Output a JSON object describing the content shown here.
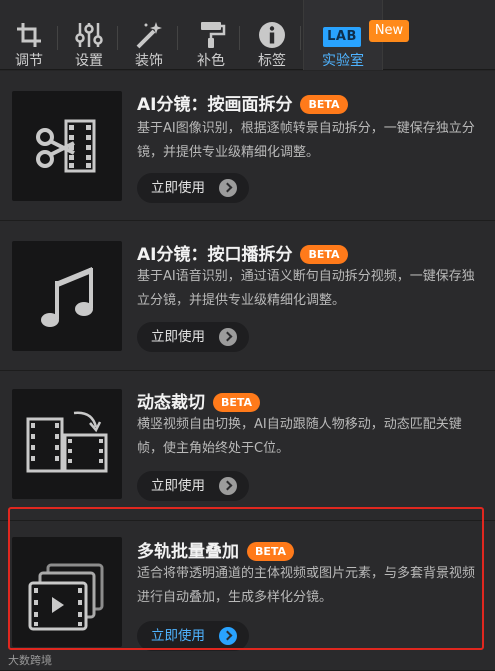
{
  "tabs": [
    {
      "label": "调节",
      "icon": "crop-icon"
    },
    {
      "label": "设置",
      "icon": "sliders-icon"
    },
    {
      "label": "装饰",
      "icon": "magic-wand-icon"
    },
    {
      "label": "补色",
      "icon": "paint-roller-icon"
    },
    {
      "label": "标签",
      "icon": "info-icon"
    },
    {
      "label": "实验室",
      "icon": "lab-icon",
      "icon_text": "LAB",
      "active": true
    }
  ],
  "new_badge": "New",
  "cards": [
    {
      "title": "AI分镜：按画面拆分",
      "badge": "BETA",
      "description": "基于AI图像识别，根据逐帧转景自动拆分，一键保存独立分镜，并提供专业级精细化调整。",
      "button": "立即使用",
      "icon": "scissors-film-icon"
    },
    {
      "title": "AI分镜：按口播拆分",
      "badge": "BETA",
      "description": "基于AI语音识别，通过语义断句自动拆分视频，一键保存独立分镜，并提供专业级精细化调整。",
      "button": "立即使用",
      "icon": "music-note-icon"
    },
    {
      "title": "动态裁切",
      "badge": "BETA",
      "description": "横竖视频自由切换，AI自动跟随人物移动，动态匹配关键帧，使主角始终处于C位。",
      "button": "立即使用",
      "icon": "dynamic-crop-icon"
    },
    {
      "title": "多轨批量叠加",
      "badge": "BETA",
      "description": "适合将带透明通道的主体视频或图片元素，与多套背景视频进行自动叠加，生成多样化分镜。",
      "button": "立即使用",
      "icon": "stacked-video-icon"
    }
  ],
  "watermark": "大数跨境",
  "colors": {
    "accent": "#29a3ff",
    "beta": "#ff7a1a",
    "highlight": "#e0271f"
  }
}
